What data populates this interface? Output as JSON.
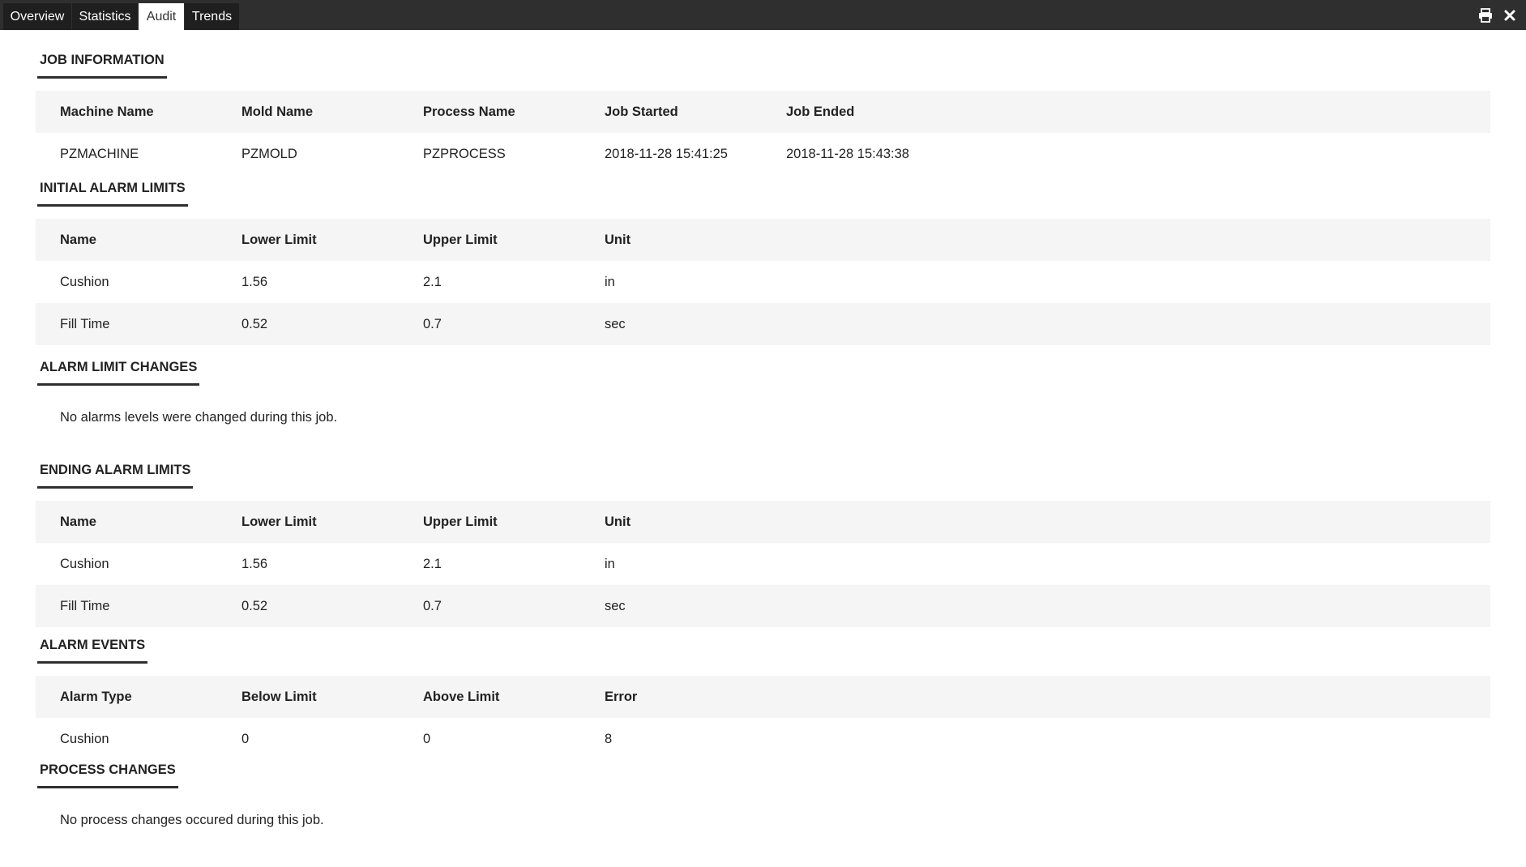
{
  "tabs": [
    {
      "label": "Overview"
    },
    {
      "label": "Statistics"
    },
    {
      "label": "Audit"
    },
    {
      "label": "Trends"
    }
  ],
  "active_tab": "Audit",
  "toolbar": {
    "print_icon": "print-icon",
    "close_icon": "close-icon"
  },
  "job_information": {
    "title": "JOB INFORMATION",
    "headers": [
      "Machine Name",
      "Mold Name",
      "Process Name",
      "Job Started",
      "Job Ended"
    ],
    "row": [
      "PZMACHINE",
      "PZMOLD",
      "PZPROCESS",
      "2018-11-28 15:41:25",
      "2018-11-28 15:43:38"
    ]
  },
  "initial_alarm_limits": {
    "title": "INITIAL ALARM LIMITS",
    "headers": [
      "Name",
      "Lower Limit",
      "Upper Limit",
      "Unit"
    ],
    "rows": [
      [
        "Cushion",
        "1.56",
        "2.1",
        "in"
      ],
      [
        "Fill Time",
        "0.52",
        "0.7",
        "sec"
      ]
    ]
  },
  "alarm_limit_changes": {
    "title": "ALARM LIMIT CHANGES",
    "message": "No alarms levels were changed during this job."
  },
  "ending_alarm_limits": {
    "title": "ENDING ALARM LIMITS",
    "headers": [
      "Name",
      "Lower Limit",
      "Upper Limit",
      "Unit"
    ],
    "rows": [
      [
        "Cushion",
        "1.56",
        "2.1",
        "in"
      ],
      [
        "Fill Time",
        "0.52",
        "0.7",
        "sec"
      ]
    ]
  },
  "alarm_events": {
    "title": "ALARM EVENTS",
    "headers": [
      "Alarm Type",
      "Below Limit",
      "Above Limit",
      "Error"
    ],
    "rows": [
      [
        "Cushion",
        "0",
        "0",
        "8"
      ]
    ]
  },
  "process_changes": {
    "title": "PROCESS CHANGES",
    "message": "No process changes occured during this job."
  }
}
